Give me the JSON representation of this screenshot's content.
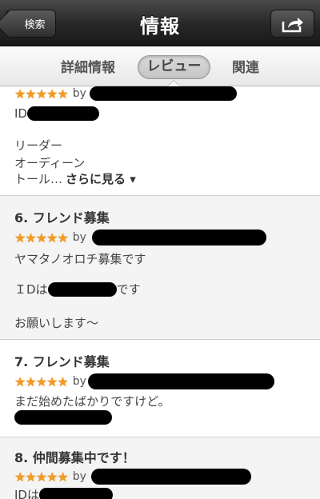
{
  "nav": {
    "back_label": "検索",
    "title": "情報",
    "share_icon": "share-icon"
  },
  "tabs": [
    {
      "label": "詳細情報",
      "selected": false
    },
    {
      "label": "レビュー",
      "selected": true
    },
    {
      "label": "関連",
      "selected": false
    }
  ],
  "reviews": [
    {
      "title": "",
      "by_label": "by",
      "lines": [
        "ID",
        "リーダー",
        "オーディーン",
        "トール…"
      ],
      "more_label": "さらに見る ▾"
    },
    {
      "title": "6. フレンド募集",
      "by_label": "by",
      "lines": [
        "ヤマタノオロチ募集です",
        "ＩDは",
        "です",
        "お願いします〜"
      ]
    },
    {
      "title": "7. フレンド募集",
      "by_label": "by",
      "lines": [
        "まだ始めたばかりですけど。"
      ]
    },
    {
      "title": "8. 仲間募集中です！",
      "by_label": "by",
      "lines": [
        "IDは"
      ]
    }
  ],
  "colors": {
    "star": "#f39a1f",
    "redaction": "#000000"
  }
}
